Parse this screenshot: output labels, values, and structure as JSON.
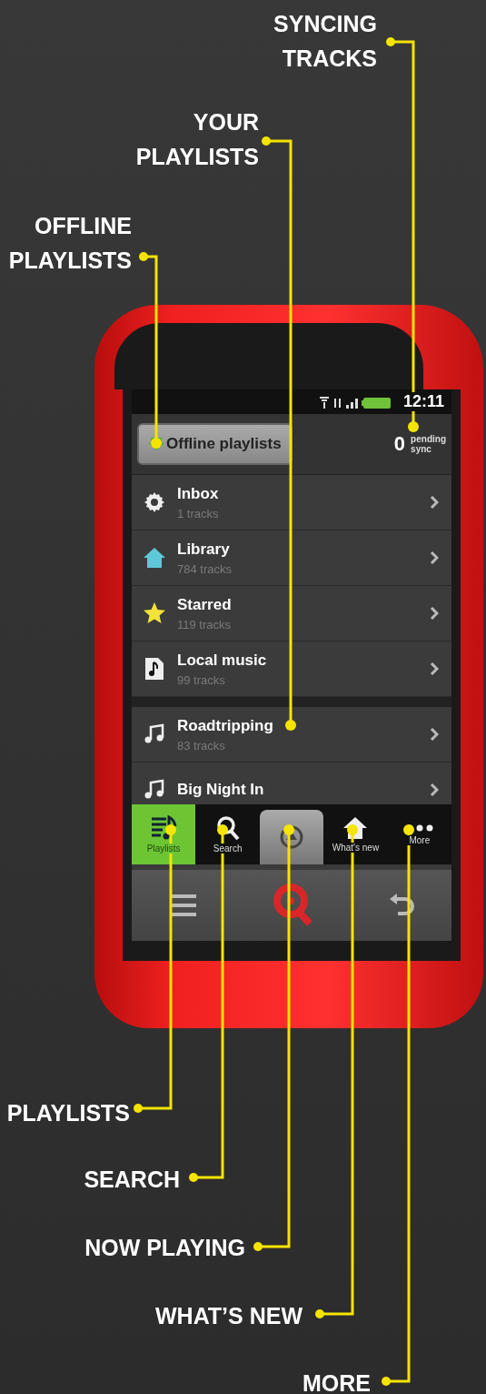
{
  "callouts": [
    {
      "label": "SYNCING\nTRACKS"
    },
    {
      "label": "YOUR\nPLAYLISTS"
    },
    {
      "label": "OFFLINE\nPLAYLISTS"
    },
    {
      "label": "PLAYLISTS"
    },
    {
      "label": "SEARCH"
    },
    {
      "label": "NOW PLAYING"
    },
    {
      "label": "WHAT’S NEW"
    },
    {
      "label": "MORE"
    }
  ],
  "status_bar": {
    "time": "12:11"
  },
  "header": {
    "offline_button": "Offline playlists",
    "pending_count": "0",
    "pending_label": "pending\nsync"
  },
  "sections": [
    {
      "items": [
        {
          "title": "Inbox",
          "subtitle": "1 tracks"
        },
        {
          "title": "Library",
          "subtitle": "784 tracks"
        },
        {
          "title": "Starred",
          "subtitle": "119 tracks"
        },
        {
          "title": "Local music",
          "subtitle": "99 tracks"
        }
      ]
    },
    {
      "items": [
        {
          "title": "Roadtripping",
          "subtitle": "83 tracks"
        },
        {
          "title": "Big Night In"
        }
      ]
    }
  ],
  "tabs": [
    {
      "kind": "tab",
      "label": "Playlists",
      "selected": true
    },
    {
      "kind": "tab",
      "label": "Search",
      "selected": false
    },
    {
      "kind": "now_playing",
      "selected": false
    },
    {
      "kind": "tab",
      "label": "What's new",
      "selected": false
    },
    {
      "kind": "tab",
      "label": "More",
      "selected": false
    }
  ]
}
